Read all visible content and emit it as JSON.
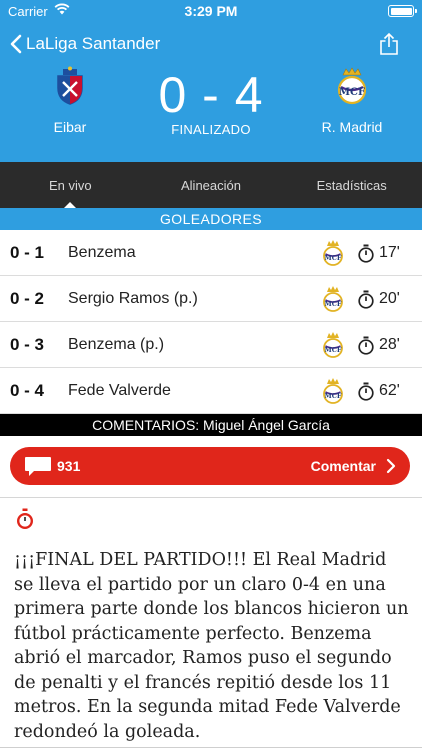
{
  "status_bar": {
    "carrier": "Carrier",
    "time": "3:29 PM"
  },
  "nav": {
    "back_label": "LaLiga Santander"
  },
  "match": {
    "home_team": "Eibar",
    "away_team": "R. Madrid",
    "score": "0 - 4",
    "status": "FINALIZADO"
  },
  "tabs": [
    {
      "label": "En vivo",
      "active": true
    },
    {
      "label": "Alineación",
      "active": false
    },
    {
      "label": "Estadísticas",
      "active": false
    }
  ],
  "scorers_header": "GOLEADORES",
  "scorers": [
    {
      "score": "0 - 1",
      "player": "Benzema",
      "minute": "17'"
    },
    {
      "score": "0 - 2",
      "player": "Sergio Ramos (p.)",
      "minute": "20'"
    },
    {
      "score": "0 - 3",
      "player": "Benzema (p.)",
      "minute": "28'"
    },
    {
      "score": "0 - 4",
      "player": "Fede Valverde",
      "minute": "62'"
    }
  ],
  "comments_header": "COMENTARIOS: Miguel Ángel García",
  "comment_button": {
    "count": "931",
    "label": "Comentar"
  },
  "live_comment": "¡¡¡FINAL DEL PARTIDO!!! El Real Madrid se lleva el partido por un claro 0-4 en una primera parte donde los blancos hicieron un fútbol prácticamente perfecto. Benzema abrió el marcador, Ramos puso el segundo de penalti y el francés repitió desde los 11 metros. En la segunda mitad Fede Valverde redondeó la goleada.",
  "colors": {
    "header_blue": "#2f9ee0",
    "tab_bar": "#2b2b2b",
    "comment_red": "#e0261b"
  }
}
